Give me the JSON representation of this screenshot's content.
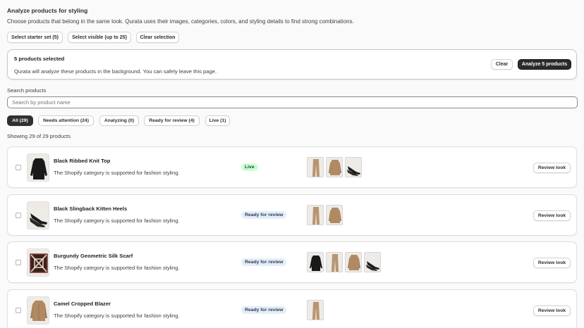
{
  "header": {
    "title": "Analyze products for styling",
    "description": "Choose products that belong in the same look. Qurata uses their images, categories, colors, and styling details to find strong combinations."
  },
  "actions": {
    "select_starter": "Select starter set (5)",
    "select_visible": "Select visible (up to 25)",
    "clear_selection": "Clear selection"
  },
  "banner": {
    "title": "5 products selected",
    "text": "Qurata will analyze these products in the background. You can safely leave this page.",
    "clear": "Clear",
    "analyze": "Analyze 5 products"
  },
  "search": {
    "label": "Search products",
    "placeholder": "Search by product name"
  },
  "tabs": [
    {
      "label": "All (29)",
      "active": true
    },
    {
      "label": "Needs attention (24)",
      "active": false
    },
    {
      "label": "Analyzing (0)",
      "active": false
    },
    {
      "label": "Ready for review (4)",
      "active": false
    },
    {
      "label": "Live (1)",
      "active": false
    }
  ],
  "showing": "Showing 29 of 29 products",
  "products": [
    {
      "name": "Black Ribbed Knit Top",
      "note": "The Shopify category is supported for fashion styling.",
      "status": "Live",
      "thumb": "black-top",
      "look": [
        "beige-pants",
        "tan-blazer",
        "black-heels"
      ],
      "action": "Review look"
    },
    {
      "name": "Black Slingback Kitten Heels",
      "note": "The Shopify category is supported for fashion styling.",
      "status": "Ready for review",
      "thumb": "black-heels",
      "look": [
        "beige-pants",
        "tan-blazer"
      ],
      "action": "Review look"
    },
    {
      "name": "Burgundy Geometric Silk Scarf",
      "note": "The Shopify category is supported for fashion styling.",
      "status": "Ready for review",
      "thumb": "scarf",
      "look": [
        "black-top",
        "beige-pants",
        "tan-blazer",
        "black-heels"
      ],
      "action": "Review look"
    },
    {
      "name": "Camel Cropped Blazer",
      "note": "The Shopify category is supported for fashion styling.",
      "status": "Ready for review",
      "thumb": "tan-blazer",
      "look": [
        "beige-pants"
      ],
      "action": "Review look"
    }
  ],
  "colors": {
    "live_bg": "#cdfed4",
    "live_text": "#0c5132",
    "review_bg": "#e3eef8",
    "review_text": "#2d3c4f",
    "dark_button": "#2b2b2b"
  }
}
